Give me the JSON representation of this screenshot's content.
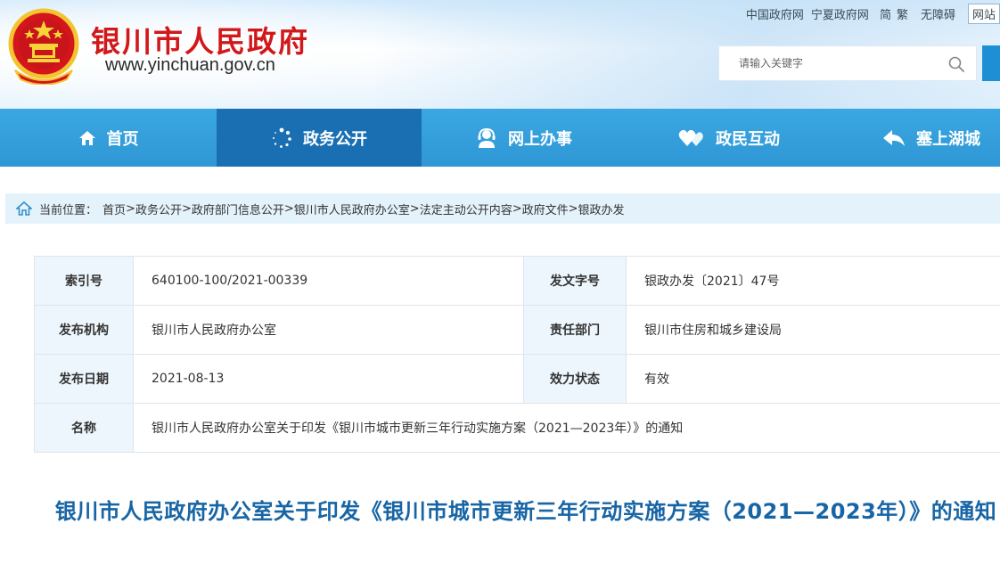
{
  "header": {
    "site_name": "银川市人民政府",
    "site_url": "www.yinchuan.gov.cn",
    "top_links": [
      "中国政府网",
      "宁夏政府网"
    ],
    "lang_simplified": "简",
    "lang_traditional": "繁",
    "accessibility": "无障碍",
    "site_nav": "网站",
    "search_placeholder": "请输入关键字"
  },
  "nav": {
    "items": [
      {
        "label": "首页",
        "icon": "home-icon"
      },
      {
        "label": "政务公开",
        "icon": "dots-circle-icon",
        "active": true
      },
      {
        "label": "网上办事",
        "icon": "service-person-icon"
      },
      {
        "label": "政民互动",
        "icon": "hearts-icon"
      },
      {
        "label": "塞上湖城",
        "icon": "share-arrow-icon"
      }
    ]
  },
  "breadcrumb": {
    "label": "当前位置：",
    "items": [
      "首页",
      "政务公开",
      "政府部门信息公开",
      "银川市人民政府办公室",
      "法定主动公开内容",
      "政府文件",
      "银政办发"
    ],
    "separator": ">"
  },
  "meta": {
    "rows": [
      {
        "k1": "索引号",
        "v1": "640100-100/2021-00339",
        "k2": "发文字号",
        "v2": "银政办发〔2021〕47号"
      },
      {
        "k1": "发布机构",
        "v1": "银川市人民政府办公室",
        "k2": "责任部门",
        "v2": "银川市住房和城乡建设局"
      },
      {
        "k1": "发布日期",
        "v1": "2021-08-13",
        "k2": "效力状态",
        "v2": "有效"
      }
    ],
    "name_key": "名称",
    "name_value": "银川市人民政府办公室关于印发《银川市城市更新三年行动实施方案（2021—2023年）》的通知"
  },
  "document": {
    "title": "银川市人民政府办公室关于印发《银川市城市更新三年行动实施方案（2021—2023年）》的通知"
  },
  "colors": {
    "brand_red": "#d1181b",
    "nav_blue": "#3aa7e2",
    "nav_active": "#1a6fb3",
    "title_blue": "#1765a5"
  }
}
